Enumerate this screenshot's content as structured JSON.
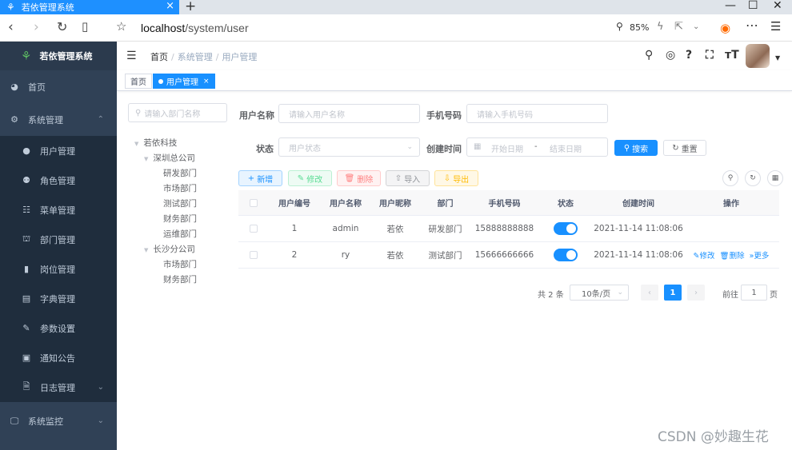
{
  "browser": {
    "tab_title": "若依管理系统",
    "url_host": "localhost",
    "url_path": "/system/user",
    "zoom": "85%"
  },
  "sidebar": {
    "brand": "若依管理系统",
    "items": [
      {
        "label": "首页",
        "icon": "dashboard-icon"
      },
      {
        "label": "系统管理",
        "icon": "gear-icon"
      },
      {
        "label": "用户管理",
        "icon": "user-icon"
      },
      {
        "label": "角色管理",
        "icon": "peoples-icon"
      },
      {
        "label": "菜单管理",
        "icon": "tree-table-icon"
      },
      {
        "label": "部门管理",
        "icon": "tree-icon"
      },
      {
        "label": "岗位管理",
        "icon": "post-icon"
      },
      {
        "label": "字典管理",
        "icon": "dict-icon"
      },
      {
        "label": "参数设置",
        "icon": "edit-icon"
      },
      {
        "label": "通知公告",
        "icon": "message-icon"
      },
      {
        "label": "日志管理",
        "icon": "log-icon"
      },
      {
        "label": "系统监控",
        "icon": "monitor-icon"
      }
    ]
  },
  "header": {
    "breadcrumb": [
      "首页",
      "系统管理",
      "用户管理"
    ]
  },
  "tags": {
    "home": "首页",
    "active": "用户管理"
  },
  "dept": {
    "search_placeholder": "请输入部门名称",
    "tree": {
      "root": "若依科技",
      "shenzhen": "深圳总公司",
      "sz_dev": "研发部门",
      "sz_market": "市场部门",
      "sz_test": "测试部门",
      "sz_finance": "财务部门",
      "sz_ops": "运维部门",
      "changsha": "长沙分公司",
      "cs_market": "市场部门",
      "cs_finance": "财务部门"
    }
  },
  "form": {
    "username_label": "用户名称",
    "username_placeholder": "请输入用户名称",
    "phone_label": "手机号码",
    "phone_placeholder": "请输入手机号码",
    "status_label": "状态",
    "status_placeholder": "用户状态",
    "created_label": "创建时间",
    "start_placeholder": "开始日期",
    "range_sep": "-",
    "end_placeholder": "结束日期",
    "search_btn": "搜索",
    "reset_btn": "重置"
  },
  "toolbar": {
    "add": "新增",
    "edit": "修改",
    "delete": "删除",
    "import": "导入",
    "export": "导出"
  },
  "table": {
    "headers": [
      "用户编号",
      "用户名称",
      "用户昵称",
      "部门",
      "手机号码",
      "状态",
      "创建时间",
      "操作"
    ],
    "rows": [
      {
        "id": "1",
        "username": "admin",
        "nickname": "若依",
        "dept": "研发部门",
        "phone": "15888888888",
        "status_on": true,
        "created": "2021-11-14 11:08:06"
      },
      {
        "id": "2",
        "username": "ry",
        "nickname": "若依",
        "dept": "测试部门",
        "phone": "15666666666",
        "status_on": true,
        "created": "2021-11-14 11:08:06"
      }
    ],
    "actions": {
      "edit": "修改",
      "delete": "删除",
      "more": "更多"
    }
  },
  "pagination": {
    "total": "共 2 条",
    "page_size": "10条/页",
    "current": "1",
    "goto_label": "前往",
    "goto_value": "1",
    "page_unit": "页"
  },
  "watermark": "CSDN @妙趣生花"
}
